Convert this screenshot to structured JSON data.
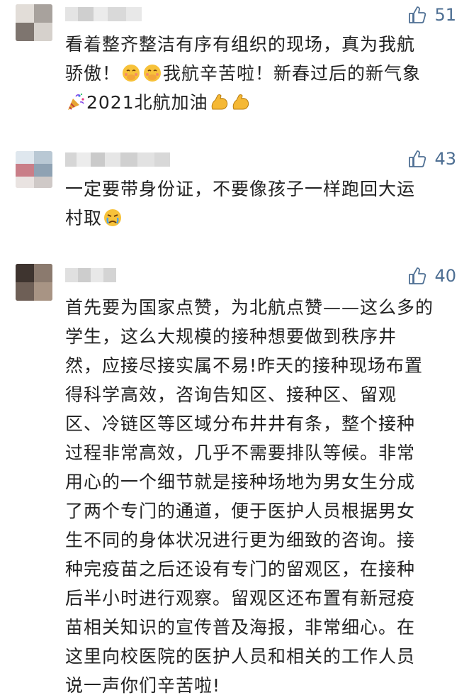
{
  "comments": [
    {
      "likes": "51",
      "lines": [
        "看着整齐整洁有序有组织的现场，真为我航",
        "骄傲！",
        "我航辛苦啦！新春过后的新气象",
        "2021北航加油"
      ]
    },
    {
      "likes": "43",
      "lines": [
        "一定要带身份证，不要像孩子一样跑回大运",
        "村取"
      ]
    },
    {
      "likes": "40",
      "lines": [
        "首先要为国家点赞，为北航点赞——这么多的",
        "学生，这么大规模的接种想要做到秩序井",
        "然，应接尽接实属不易!昨天的接种现场布置",
        "得科学高效，咨询告知区、接种区、留观",
        "区、冷链区等区域分布井井有条，整个接种",
        "过程非常高效，几乎不需要排队等候。非常",
        "用心的一个细节就是接种场地为男女生分成",
        "了两个专门的通道，便于医护人员根据男女",
        "生不同的身体状况进行更为细致的咨询。接",
        "种完疫苗之后还设有专门的留观区，在接种",
        "后半小时进行观察。留观区还布置有新冠疫",
        "苗相关知识的宣传普及海报，非常细心。在",
        "这里向校医院的医护人员和相关的工作人员",
        "说一声你们辛苦啦!"
      ]
    }
  ],
  "icons": {
    "like": "thumbs-up-icon",
    "emoji_blush": "covering-mouth-face-emoji",
    "emoji_party": "party-popper-emoji",
    "emoji_muscle": "flexed-biceps-emoji",
    "emoji_crying": "crying-face-emoji"
  },
  "colors": {
    "like_accent": "#4e6f93",
    "text": "#222222"
  }
}
